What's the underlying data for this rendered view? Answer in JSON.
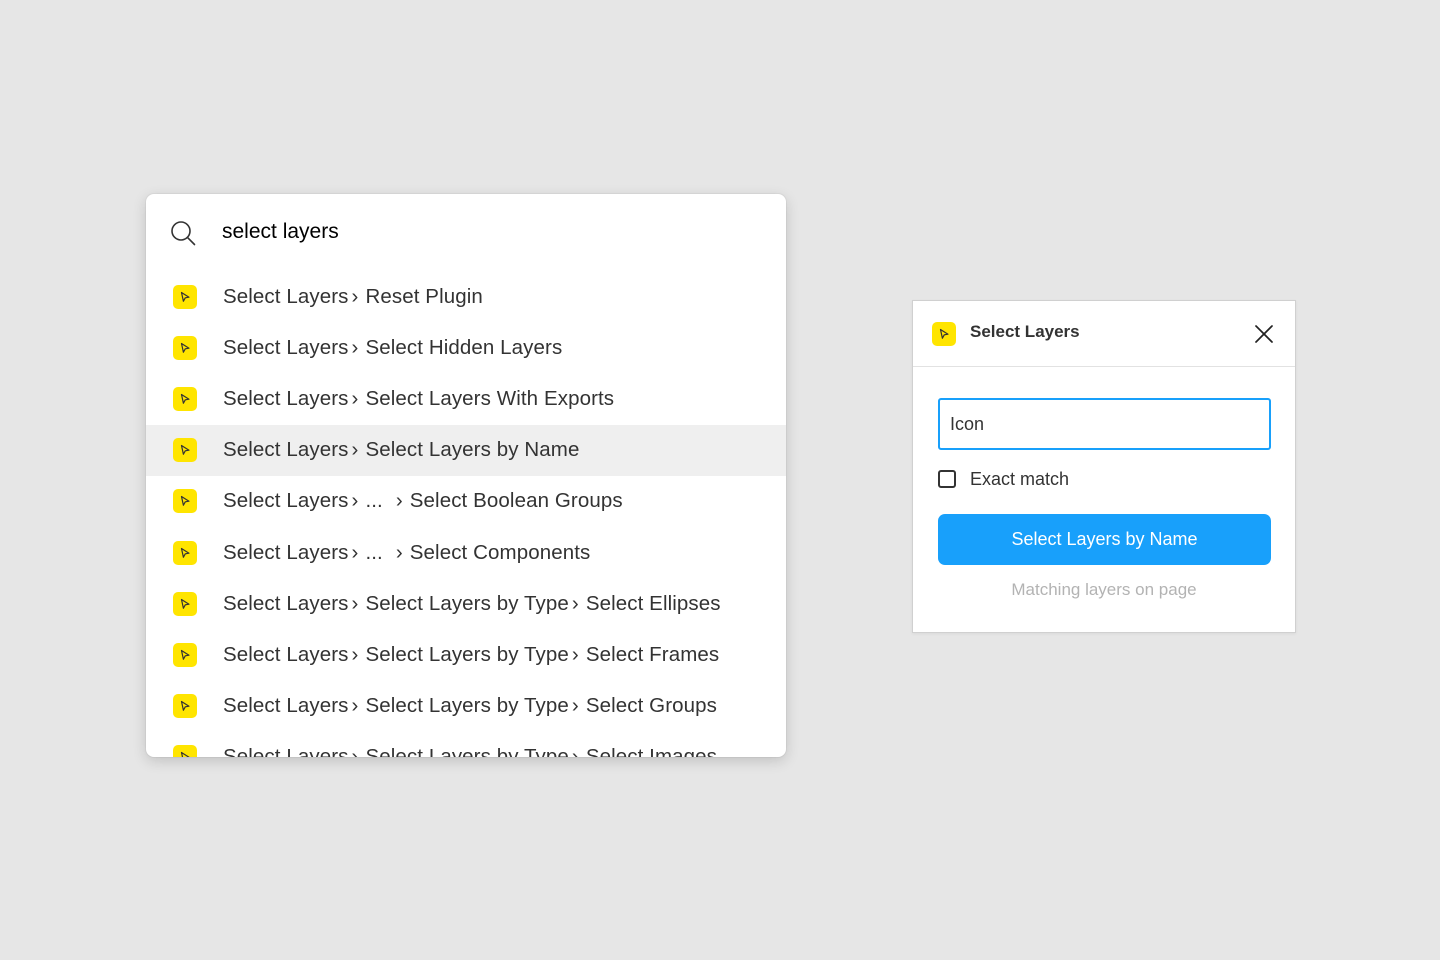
{
  "palette": {
    "search": {
      "value": "select layers",
      "icon": "search-icon"
    },
    "results": [
      {
        "parts": [
          "Select Layers",
          "Reset Plugin"
        ],
        "highlighted": false
      },
      {
        "parts": [
          "Select Layers",
          "Select Hidden Layers"
        ],
        "highlighted": false
      },
      {
        "parts": [
          "Select Layers",
          "Select Layers With Exports"
        ],
        "highlighted": false
      },
      {
        "parts": [
          "Select Layers",
          "Select Layers by Name"
        ],
        "highlighted": true
      },
      {
        "parts": [
          "Select Layers",
          "...",
          "Select Boolean Groups"
        ],
        "highlighted": false
      },
      {
        "parts": [
          "Select Layers",
          "...",
          "Select Components"
        ],
        "highlighted": false
      },
      {
        "parts": [
          "Select Layers",
          "Select Layers by Type",
          "Select Ellipses"
        ],
        "highlighted": false
      },
      {
        "parts": [
          "Select Layers",
          "Select Layers by Type",
          "Select Frames"
        ],
        "highlighted": false
      },
      {
        "parts": [
          "Select Layers",
          "Select Layers by Type",
          "Select Groups"
        ],
        "highlighted": false
      },
      {
        "parts": [
          "Select Layers",
          "Select Layers by Type",
          "Select Images"
        ],
        "highlighted": false
      }
    ],
    "separator_glyph": "›"
  },
  "plugin_panel": {
    "title": "Select Layers",
    "name_input": {
      "value": "Icon"
    },
    "exact_match": {
      "label": "Exact match",
      "checked": false
    },
    "primary_button": "Select Layers by Name",
    "hint": "Matching layers on page"
  },
  "colors": {
    "accent": "#18a0fb",
    "plugin_badge": "#ffe500",
    "highlight_row": "#efefef",
    "background": "#e6e6e6"
  }
}
